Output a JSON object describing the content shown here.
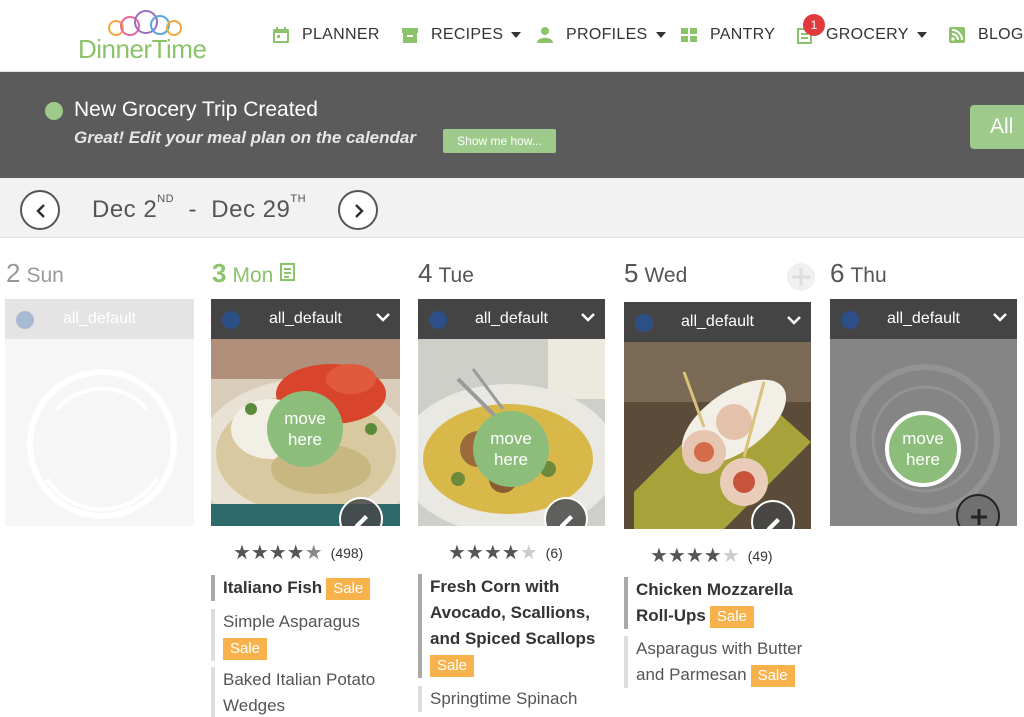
{
  "nav": {
    "logo": {
      "word_left": "Dinner",
      "word_right": "Time"
    },
    "items": [
      {
        "label": "PLANNER",
        "icon": "calendar-icon",
        "has_caret": false
      },
      {
        "label": "RECIPES",
        "icon": "recipe-box-icon",
        "has_caret": true
      },
      {
        "label": "PROFILES",
        "icon": "user-icon",
        "has_caret": true
      },
      {
        "label": "PANTRY",
        "icon": "grid-icon",
        "has_caret": false
      },
      {
        "label": "GROCERY",
        "icon": "grocery-list-icon",
        "has_caret": true,
        "badge": "1"
      },
      {
        "label": "BLOG",
        "icon": "rss-icon",
        "has_caret": false
      }
    ]
  },
  "notice": {
    "title": "New Grocery Trip Created",
    "subtitle": "Great! Edit your meal plan on the calendar",
    "show_button": "Show me how...",
    "all_button": "All"
  },
  "daterange": {
    "start_month": "Dec",
    "start_day": "2",
    "start_suffix": "ND",
    "separator": "-",
    "end_month": "Dec",
    "end_day": "29",
    "end_suffix": "TH"
  },
  "days": [
    {
      "num": "2",
      "weekday": "Sun",
      "category": "all_default"
    },
    {
      "num": "3",
      "weekday": "Mon",
      "category": "all_default"
    },
    {
      "num": "4",
      "weekday": "Tue",
      "category": "all_default"
    },
    {
      "num": "5",
      "weekday": "Wed",
      "category": "all_default"
    },
    {
      "num": "6",
      "weekday": "Thu",
      "category": "all_default"
    }
  ],
  "move_here": {
    "line1": "move",
    "line2": "here"
  },
  "meals": {
    "mon": {
      "rating_stars": 4.5,
      "rating_count": "(498)",
      "main": "Italiano Fish",
      "main_sale": "Sale",
      "sides": [
        {
          "name": "Simple Asparagus",
          "sale": "Sale"
        },
        {
          "name": "Baked Italian Potato Wedges",
          "sale": ""
        }
      ]
    },
    "tue": {
      "rating_stars": 4,
      "rating_count": "(6)",
      "main": "Fresh Corn with Avocado, Scallions, and Spiced Scallops",
      "main_sale": "Sale",
      "sides": [
        {
          "name": "Springtime Spinach",
          "sale": ""
        }
      ]
    },
    "wed": {
      "rating_stars": 4,
      "rating_count": "(49)",
      "main": "Chicken Mozzarella Roll-Ups",
      "main_sale": "Sale",
      "sides": [
        {
          "name": "Asparagus with Butter and Parmesan",
          "sale": "Sale"
        }
      ]
    }
  },
  "colors": {
    "brand_green": "#8cc36a",
    "notice_bg": "#5b5b5b",
    "sale_orange": "#f7b24c",
    "badge_red": "#e0393e"
  }
}
